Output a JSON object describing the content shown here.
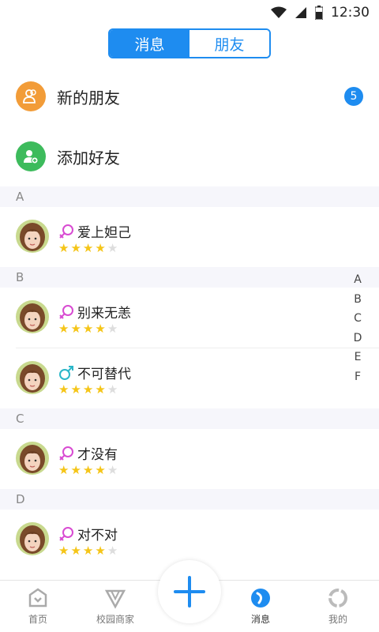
{
  "status_bar": {
    "time": "12:30"
  },
  "tabs": [
    {
      "label": "消息",
      "active": true
    },
    {
      "label": "朋友",
      "active": false
    }
  ],
  "actions": [
    {
      "label": "新的朋友",
      "icon": "friends-icon",
      "color": "#f29c38",
      "badge": "5"
    },
    {
      "label": "添加好友",
      "icon": "add-friend-icon",
      "color": "#3dbb5c"
    }
  ],
  "sections": [
    {
      "letter": "A",
      "contacts": [
        {
          "name": "爱上妲己",
          "gender": "female",
          "rating": 4
        }
      ]
    },
    {
      "letter": "B",
      "contacts": [
        {
          "name": "别来无恙",
          "gender": "female",
          "rating": 4
        },
        {
          "name": "不可替代",
          "gender": "male",
          "rating": 4
        }
      ]
    },
    {
      "letter": "C",
      "contacts": [
        {
          "name": "才没有",
          "gender": "female",
          "rating": 4
        }
      ]
    },
    {
      "letter": "D",
      "contacts": [
        {
          "name": "对不对",
          "gender": "female",
          "rating": 4
        }
      ]
    }
  ],
  "index_letters": [
    "A",
    "B",
    "C",
    "D",
    "E",
    "F"
  ],
  "bottom_nav": [
    {
      "label": "首页",
      "icon": "home-icon",
      "active": false
    },
    {
      "label": "校园商家",
      "icon": "campus-shop-icon",
      "active": false
    },
    {
      "label": "消息",
      "icon": "message-icon",
      "active": true
    },
    {
      "label": "我的",
      "icon": "profile-icon",
      "active": false
    }
  ],
  "colors": {
    "accent": "#1e8cf0",
    "female": "#d84bd2",
    "male": "#2ab6c8",
    "star": "#f5c518"
  }
}
